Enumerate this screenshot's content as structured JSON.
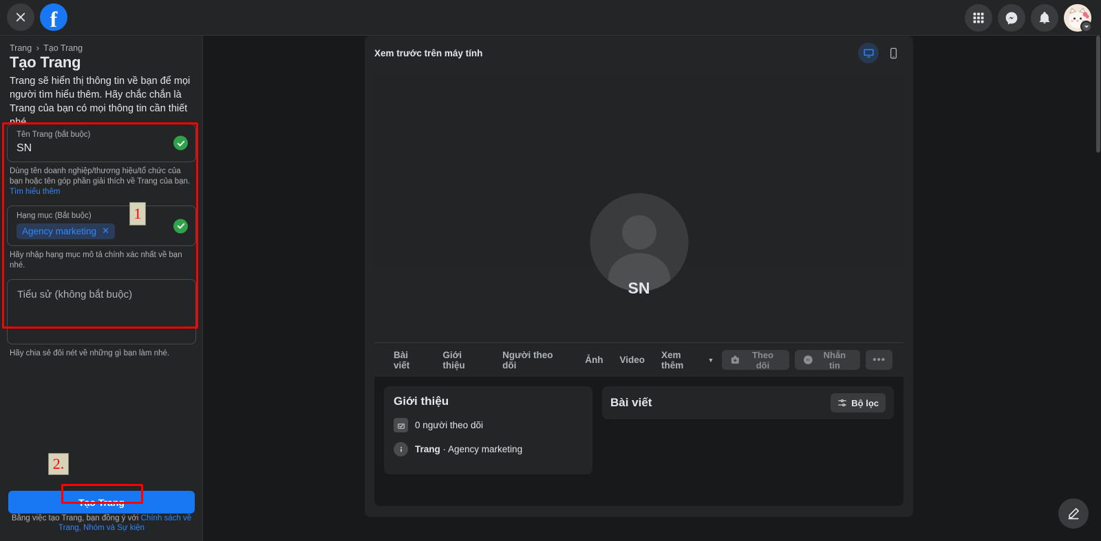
{
  "topbar": {
    "close_label": "close-icon",
    "logo_letter": "f",
    "icons": [
      {
        "name": "apps-grid-icon",
        "label": "Menu"
      },
      {
        "name": "messenger-icon",
        "label": "Messenger"
      },
      {
        "name": "notifications-bell-icon",
        "label": "Thông báo"
      }
    ],
    "avatar_label": "Tài khoản"
  },
  "left": {
    "breadcrumb_root": "Trang",
    "breadcrumb_sep": "›",
    "breadcrumb_current": "Tạo Trang",
    "title": "Tạo Trang",
    "description": "Trang sẽ hiển thị thông tin về bạn để mọi người tìm hiểu thêm. Hãy chắc chắn là Trang của bạn có mọi thông tin cần thiết nhé.",
    "name_field": {
      "label": "Tên Trang (bắt buộc)",
      "value": "SN",
      "valid": true,
      "helper_text": "Dùng tên doanh nghiệp/thương hiệu/tổ chức của bạn hoặc tên góp phần giải thích về Trang của bạn.",
      "helper_link": "Tìm hiểu thêm"
    },
    "category_field": {
      "label": "Hạng mục (Bắt buộc)",
      "chip": "Agency marketing",
      "chip_remove": "✕",
      "valid": true,
      "helper_text": "Hãy nhập hạng mục mô tả chính xác nhất về bạn nhé."
    },
    "bio_field": {
      "placeholder": "Tiểu sử (không bắt buộc)",
      "value": "",
      "helper_text": "Hãy chia sẻ đôi nét về những gì bạn làm nhé."
    },
    "cta_label": "Tạo Trang",
    "legal_prefix": "Bằng việc tạo Trang, bạn đồng ý với ",
    "legal_link": "Chính sách về Trang, Nhóm và Sự kiện"
  },
  "annotations": [
    {
      "id": "1",
      "label": "1"
    },
    {
      "id": "2",
      "label": "2."
    }
  ],
  "preview": {
    "header_title": "Xem trước trên máy tính",
    "devices": [
      {
        "name": "desktop-preview-toggle",
        "label": "Máy tính",
        "active": true
      },
      {
        "name": "mobile-preview-toggle",
        "label": "Điện thoại",
        "active": false
      }
    ],
    "page_name": "SN",
    "tabs": [
      {
        "label": "Bài viết"
      },
      {
        "label": "Giới thiệu"
      },
      {
        "label": "Người theo dõi"
      },
      {
        "label": "Ảnh"
      },
      {
        "label": "Video"
      },
      {
        "label": "Xem thêm",
        "caret": "▼"
      }
    ],
    "actions": [
      {
        "label": "Theo dõi",
        "icon": "follow-plus-icon"
      },
      {
        "label": "Nhắn tin",
        "icon": "messenger-icon"
      },
      {
        "label": "•••",
        "icon": "more-options-icon"
      }
    ],
    "about_card": {
      "title": "Giới thiệu",
      "rows": [
        {
          "icon": "followers-icon",
          "text": "0 người theo dõi"
        },
        {
          "icon": "info-icon",
          "text_bold": "Trang",
          "text_rest": " · Agency marketing"
        }
      ]
    },
    "posts_card": {
      "title": "Bài viết",
      "filter_label": "Bộ lọc"
    }
  },
  "fab": {
    "name": "compose-icon",
    "label": "Tạo bài viết"
  },
  "colors": {
    "accent_blue": "#1877f2",
    "link_blue": "#2d88ff",
    "valid_green": "#31a24c",
    "annotation_red": "#ff0000",
    "bg_dark": "#18191a",
    "panel_dark": "#242526"
  }
}
